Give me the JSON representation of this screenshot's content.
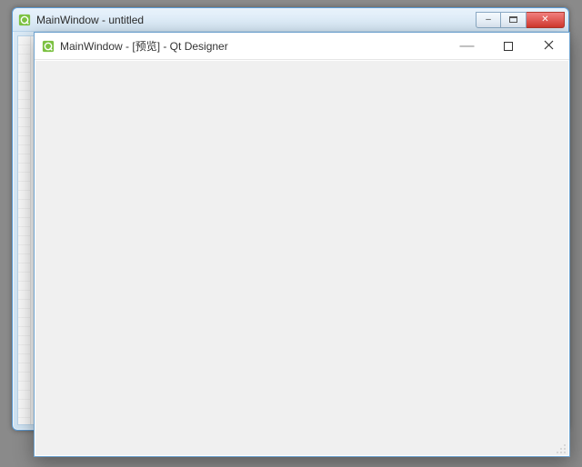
{
  "back_window": {
    "title": "MainWindow - untitled",
    "controls": {
      "minimize": "–",
      "maximize": "",
      "close": "✕"
    }
  },
  "front_window": {
    "title": "MainWindow - [预览] - Qt Designer",
    "controls": {
      "minimize": "—",
      "maximize": "",
      "close": ""
    }
  },
  "icons": {
    "qt_fill": "#7cc142"
  }
}
